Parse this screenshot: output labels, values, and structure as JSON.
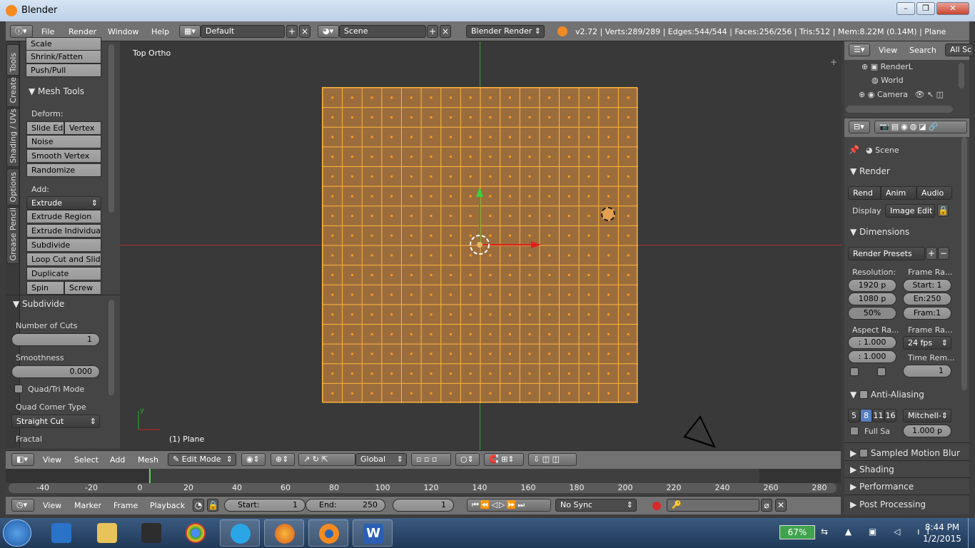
{
  "window": {
    "title": "Blender",
    "controls": [
      "–",
      "❐",
      "✕"
    ]
  },
  "info_header": {
    "menus": [
      "File",
      "Render",
      "Window",
      "Help"
    ],
    "layout": "Default",
    "scene": "Scene",
    "engine": "Blender Render",
    "stats": "v2.72 | Verts:289/289 | Edges:544/544 | Faces:256/256 | Tris:512 | Mem:8.22M (0.14M) | Plane"
  },
  "tool_tabs": [
    "Tools",
    "Create",
    "Shading / UVs",
    "Options",
    "Grease Pencil"
  ],
  "tools": {
    "top_buttons": [
      "Scale",
      "Shrink/Fatten",
      "Push/Pull"
    ],
    "mesh_tools_header": "Mesh Tools",
    "deform_label": "Deform:",
    "slide_edge": "Slide Ed",
    "vertex": "Vertex",
    "noise": "Noise",
    "smooth_vertex": "Smooth Vertex",
    "randomize": "Randomize",
    "add_label": "Add:",
    "extrude": "Extrude",
    "extrude_region": "Extrude Region",
    "extrude_individual": "Extrude Individual",
    "subdivide": "Subdivide",
    "loop_cut": "Loop Cut and Slide",
    "duplicate": "Duplicate",
    "spin": "Spin",
    "screw": "Screw"
  },
  "operator": {
    "header": "Subdivide",
    "cuts_label": "Number of Cuts",
    "cuts_value": "1",
    "smoothness_label": "Smoothness",
    "smoothness_value": "0.000",
    "quad_tri": "Quad/Tri Mode",
    "corner_label": "Quad Corner Type",
    "corner_value": "Straight Cut",
    "fractal_label": "Fractal"
  },
  "viewport": {
    "view_name": "Top Ortho",
    "object_label": "(1) Plane",
    "grid_cells": 16
  },
  "vp_header": {
    "menus": [
      "View",
      "Select",
      "Add",
      "Mesh"
    ],
    "mode": "Edit Mode",
    "orientation": "Global"
  },
  "timeline": {
    "ticks": [
      "-40",
      "-20",
      "0",
      "20",
      "40",
      "60",
      "80",
      "100",
      "120",
      "140",
      "160",
      "180",
      "200",
      "220",
      "240",
      "260",
      "280"
    ],
    "menus": [
      "View",
      "Marker",
      "Frame",
      "Playback"
    ],
    "start_label": "Start:",
    "start_value": "1",
    "end_label": "End:",
    "end_value": "250",
    "current_frame": "1",
    "sync": "No Sync"
  },
  "outliner": {
    "menus": [
      "View",
      "Search"
    ],
    "filter": "All Sc",
    "items": [
      "RenderL",
      "World",
      "Camera"
    ]
  },
  "properties": {
    "scene_label": "Scene",
    "render_header": "Render",
    "render_btns": [
      "Rend",
      "Anim",
      "Audio"
    ],
    "display_label": "Display",
    "display_value": "Image Edit",
    "dimensions_header": "Dimensions",
    "presets": "Render Presets",
    "resolution_label": "Resolution:",
    "frame_range_label": "Frame Ra...",
    "res_x": "1920 p",
    "res_y": "1080 p",
    "res_pct": "50%",
    "start": "Start: 1",
    "end": "En:250",
    "frame_step": "Fram:1",
    "aspect_label": "Aspect Ra...",
    "frame_rate_label": "Frame Ra...",
    "aspect_x": ": 1.000",
    "aspect_y": ": 1.000",
    "fps": "24 fps",
    "time_remap_label": "Time Rem...",
    "time_remap_value": "1",
    "aa_header": "Anti-Aliasing",
    "aa_samples": [
      "5",
      "8",
      "11",
      "16"
    ],
    "aa_filter": "Mitchell-",
    "full_sample": "Full Sa",
    "aa_size": "1.000 p",
    "collapsed": [
      "Sampled Motion Blur",
      "Shading",
      "Performance",
      "Post Processing"
    ]
  },
  "taskbar": {
    "battery": "67%",
    "time": "8:44 PM",
    "date": "1/2/2015"
  }
}
